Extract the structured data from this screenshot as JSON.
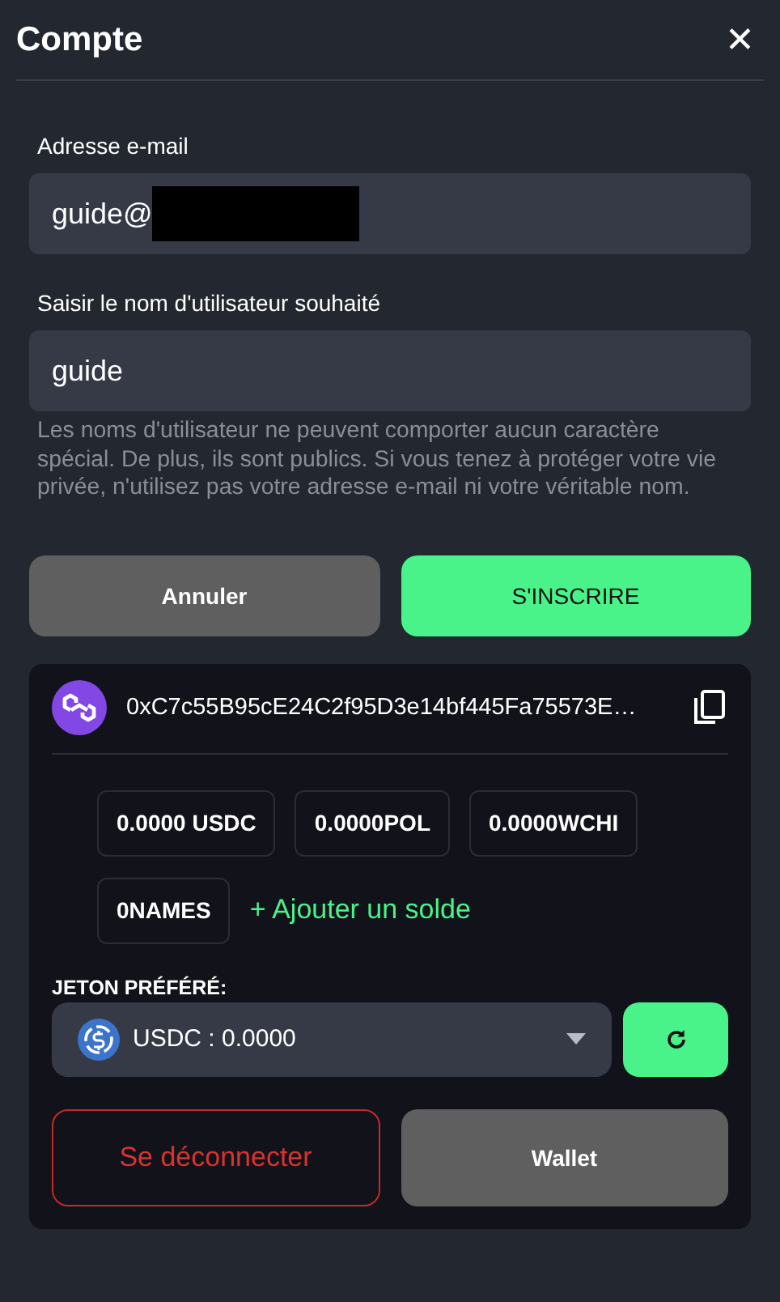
{
  "dialog": {
    "title": "Compte",
    "close": "✕"
  },
  "form": {
    "fields": [
      {
        "label": "Adresse e-mail",
        "value": "guide@",
        "redacted": true
      },
      {
        "label": "Saisir le nom d'utilisateur souhaité",
        "value": "guide",
        "redacted": false
      }
    ],
    "help": "Les noms d'utilisateur ne peuvent comporter aucun caractère spécial. De plus, ils sont publics. Si vous tenez à protéger votre vie privée, n'utilisez pas votre adresse e-mail ni votre véritable nom.",
    "buttons": [
      {
        "label": "Annuler",
        "kind": "secondary"
      },
      {
        "label": "S'INSCRIRE",
        "kind": "primary"
      }
    ]
  },
  "wallet": {
    "address": "0xC7c55B95cE24C2f95D3e14bf445Fa75573E…",
    "balances": [
      "0.0000 USDC",
      "0.0000POL",
      "0.0000WCHI",
      "0NAMES"
    ],
    "add_balance": "+ Ajouter un solde",
    "token_label": "JETON PRÉFÉRÉ:",
    "token_select": "USDC : 0.0000",
    "buttons": [
      {
        "label": "Se déconnecter",
        "kind": "danger"
      },
      {
        "label": "Wallet",
        "kind": "secondary"
      }
    ]
  }
}
